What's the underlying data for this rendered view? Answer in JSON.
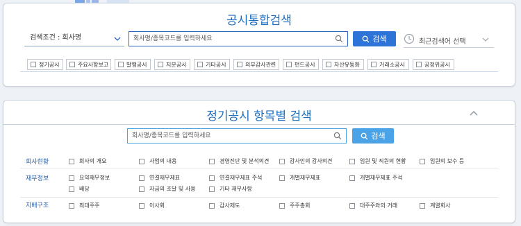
{
  "panel1": {
    "title": "공시통합검색",
    "condition_label": "검색조건 : 회사명",
    "search_placeholder": "회사명/종목코드를 입력하세요",
    "search_button": "검색",
    "recent_label": "최근검색어 선택",
    "filters": [
      "정기공시",
      "주요사항보고",
      "발행공시",
      "지분공시",
      "기타공시",
      "외부감사관련",
      "펀드공시",
      "자산유동화",
      "거래소공시",
      "공정위공시"
    ]
  },
  "panel2": {
    "title": "정기공시 항목별 검색",
    "search_placeholder": "회사명/종목코드를 입력하세요",
    "search_button": "검색",
    "categories": [
      {
        "label": "회사현황",
        "items": [
          "회사의 개요",
          "사업의 내용",
          "경영진단 및 분석의견",
          "감사인의 감사의견",
          "임원 및 직원의 현황",
          "임원의 보수 등"
        ]
      },
      {
        "label": "재무정보",
        "items": [
          "요약재무정보",
          "연결재무제표",
          "연결재무제표 주석",
          "개별재무제표",
          "개별재무제표 주석",
          "배당",
          "자금의 조달 및 사용",
          "기타 재무사항"
        ]
      },
      {
        "label": "지배구조",
        "items": [
          "최대주주",
          "이사회",
          "감사제도",
          "주주총회",
          "대주주와의 거래",
          "계열회사"
        ]
      }
    ]
  },
  "colors": {
    "accent": "#1f6fbf",
    "button": "#2e74d8",
    "button_light": "#4aa3e6"
  }
}
